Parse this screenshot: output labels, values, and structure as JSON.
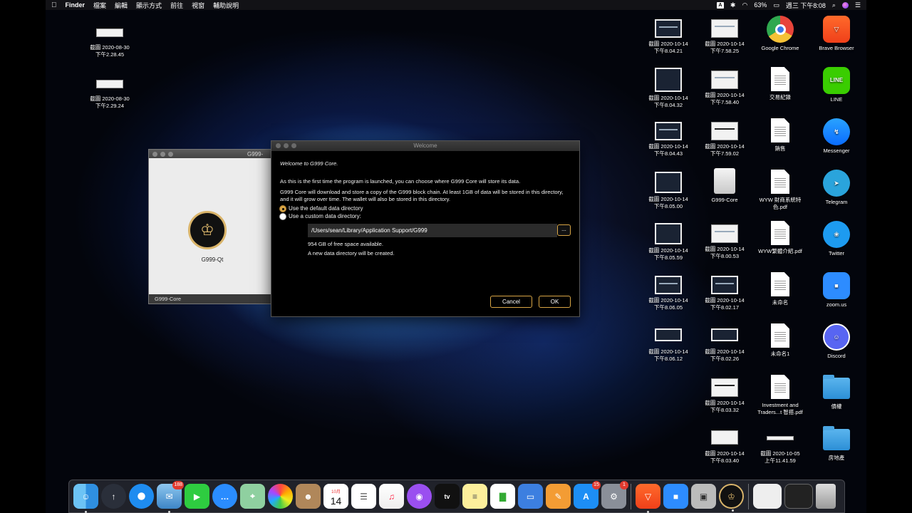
{
  "menubar": {
    "app": "Finder",
    "menus": [
      "檔案",
      "編輯",
      "顯示方式",
      "前往",
      "視窗",
      "輔助說明"
    ],
    "input_indicator": "A",
    "battery": "63%",
    "clock": "週三 下午8:08"
  },
  "desktop": {
    "left_icons": [
      {
        "label": "截圖 2020-08-30\n下午2.28.45"
      },
      {
        "label": "截圖 2020-08-30\n下午2.29.24"
      }
    ],
    "col1": [
      {
        "label": "截圖 2020-10-14\n下午8.04.21"
      },
      {
        "label": "截圖 2020-10-14\n下午8.04.32"
      },
      {
        "label": "截圖 2020-10-14\n下午8.04.43"
      },
      {
        "label": "截圖 2020-10-14\n下午8.05.00"
      },
      {
        "label": "截圖 2020-10-14\n下午8.05.59"
      },
      {
        "label": "截圖 2020-10-14\n下午8.06.05"
      },
      {
        "label": "截圖 2020-10-14\n下午8.06.12"
      }
    ],
    "col2": [
      {
        "label": "截圖 2020-10-14\n下午7.58.25"
      },
      {
        "label": "截圖 2020-10-14\n下午7.58.40"
      },
      {
        "label": "截圖 2020-10-14\n下午7.59.02"
      },
      {
        "label": "G999-Core"
      },
      {
        "label": "截圖 2020-10-14\n下午8.00.53"
      },
      {
        "label": "截圖 2020-10-14\n下午8.02.17"
      },
      {
        "label": "截圖 2020-10-14\n下午8.02.26"
      },
      {
        "label": "截圖 2020-10-14\n下午8.03.32"
      },
      {
        "label": "截圖 2020-10-14\n下午8.03.40"
      }
    ],
    "col3": [
      {
        "label": "Google Chrome"
      },
      {
        "label": "交易紀錄"
      },
      {
        "label": "銷售"
      },
      {
        "label": "WYW 財商系統特\n色.pdf"
      },
      {
        "label": "WYW繁體介紹.pdf"
      },
      {
        "label": "未命名"
      },
      {
        "label": "未命名1"
      },
      {
        "label": "Investment and\nTraders...t 智搭.pdf"
      },
      {
        "label": "截圖 2020-10-05\n上午11.41.59"
      }
    ],
    "col4": [
      {
        "label": "Brave Browser"
      },
      {
        "label": "LINE"
      },
      {
        "label": "Messenger"
      },
      {
        "label": "Telegram"
      },
      {
        "label": "Twitter"
      },
      {
        "label": "zoom.us"
      },
      {
        "label": "Discord"
      },
      {
        "label": "債權"
      },
      {
        "label": "房地產"
      }
    ]
  },
  "qt_window": {
    "title": "G999-",
    "app_label": "G999-Qt",
    "footer": "G999-Core"
  },
  "dialog": {
    "title": "Welcome",
    "heading": "Welcome to G999 Core.",
    "intro": "As this is the first time the program is launched, you can choose where G999 Core will store its data.",
    "details": "G999 Core will download and store a copy of the G999 block chain. At least 1GB of data will be stored in this directory, and it will grow over time. The wallet will also be stored in this directory.",
    "option_default": "Use the default data directory",
    "option_custom": "Use a custom data directory:",
    "path_value": "/Users/sean/Library/Application Support/G999",
    "browse_label": "...",
    "free_space": "954 GB of free space available.",
    "new_dir_note": "A new data directory will be created.",
    "cancel_label": "Cancel",
    "ok_label": "OK",
    "accent_color": "#d8a545"
  },
  "dock": {
    "badges": {
      "mail": "188",
      "appstore": "15",
      "settings": "1"
    },
    "calendar_day": "14",
    "calendar_month": "10月",
    "tv_label": "tv"
  }
}
